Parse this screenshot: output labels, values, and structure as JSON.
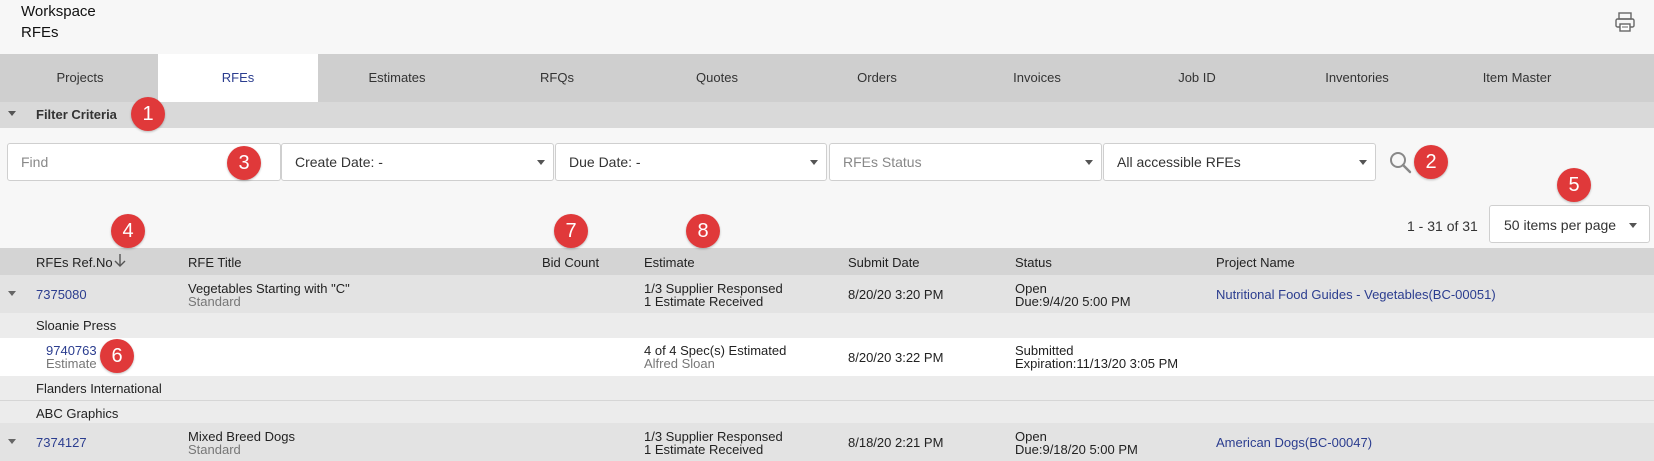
{
  "header": {
    "line1": "Workspace",
    "line2": "RFEs",
    "print_icon": "printer-icon"
  },
  "tabs": [
    {
      "label": "Projects"
    },
    {
      "label": "RFEs"
    },
    {
      "label": "Estimates"
    },
    {
      "label": "RFQs"
    },
    {
      "label": "Quotes"
    },
    {
      "label": "Orders"
    },
    {
      "label": "Invoices"
    },
    {
      "label": "Job ID"
    },
    {
      "label": "Inventories"
    },
    {
      "label": "Item Master"
    }
  ],
  "active_tab": "RFEs",
  "filter": {
    "label": "Filter Criteria",
    "find_placeholder": "Find",
    "create_date": "Create Date: -",
    "due_date": "Due Date: -",
    "status_placeholder": "RFEs Status",
    "scope": "All accessible RFEs"
  },
  "pagination": {
    "count": "1 - 31 of 31",
    "per_page": "50 items per page"
  },
  "columns": [
    "RFEs Ref.No",
    "RFE Title",
    "Bid Count",
    "Estimate",
    "Submit Date",
    "Status",
    "Project Name"
  ],
  "rows": {
    "r1": {
      "ref": "7375080",
      "title": "Vegetables Starting with \"C\"",
      "title_sub": "Standard",
      "estimate": "1/3 Supplier Responsed",
      "estimate_sub": "1 Estimate Received",
      "submit": "8/20/20 3:20 PM",
      "status": "Open",
      "status_sub": "Due:9/4/20 5:00 PM",
      "project": "Nutritional Food Guides - Vegetables(BC-00051)"
    },
    "supplier1": "Sloanie Press",
    "estimate_row": {
      "ref": "9740763",
      "ref_sub": "Estimate",
      "estimate": "4 of 4 Spec(s) Estimated",
      "estimate_sub": "Alfred Sloan",
      "submit": "8/20/20 3:22 PM",
      "status": "Submitted",
      "status_sub": "Expiration:11/13/20 3:05 PM"
    },
    "supplier2": "Flanders International",
    "supplier3": "ABC Graphics",
    "r2": {
      "ref": "7374127",
      "title": "Mixed Breed Dogs",
      "title_sub": "Standard",
      "estimate": "1/3 Supplier Responsed",
      "estimate_sub": "1 Estimate Received",
      "submit": "8/18/20 2:21 PM",
      "status": "Open",
      "status_sub": "Due:9/18/20 5:00 PM",
      "project": "American Dogs(BC-00047)"
    }
  },
  "annotations": [
    "1",
    "2",
    "3",
    "4",
    "5",
    "6",
    "7",
    "8"
  ],
  "colors": {
    "accent": "#2b3d8f",
    "badge": "#e0393a",
    "tab_bar": "#cfcfcf"
  }
}
